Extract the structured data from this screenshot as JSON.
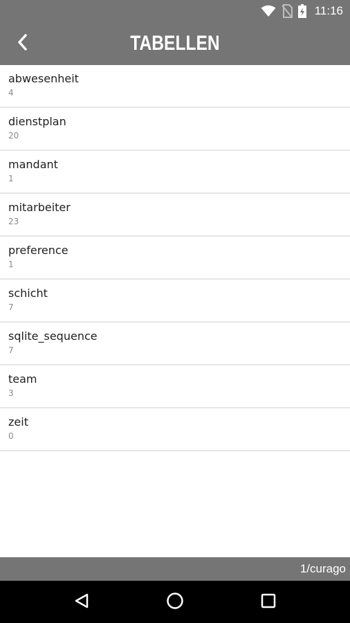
{
  "status_bar": {
    "time": "11:16",
    "icons": [
      "wifi-icon",
      "no-sim-icon",
      "battery-icon"
    ]
  },
  "app_bar": {
    "title": "TABELLEN",
    "back_icon": "chevron-left-icon"
  },
  "tables": [
    {
      "name": "abwesenheit",
      "count": "4"
    },
    {
      "name": "dienstplan",
      "count": "20"
    },
    {
      "name": "mandant",
      "count": "1"
    },
    {
      "name": "mitarbeiter",
      "count": "23"
    },
    {
      "name": "preference",
      "count": "1"
    },
    {
      "name": "schicht",
      "count": "7"
    },
    {
      "name": "sqlite_sequence",
      "count": "7"
    },
    {
      "name": "team",
      "count": "3"
    },
    {
      "name": "zeit",
      "count": "0"
    }
  ],
  "footer": {
    "path": "1/curago"
  },
  "nav_bar": {
    "icons": [
      "back-triangle-icon",
      "home-circle-icon",
      "recents-square-icon"
    ]
  },
  "colors": {
    "bar": "#757575",
    "nav": "#000000",
    "text": "#1f1f1f",
    "subtext": "#8a8a8a"
  }
}
